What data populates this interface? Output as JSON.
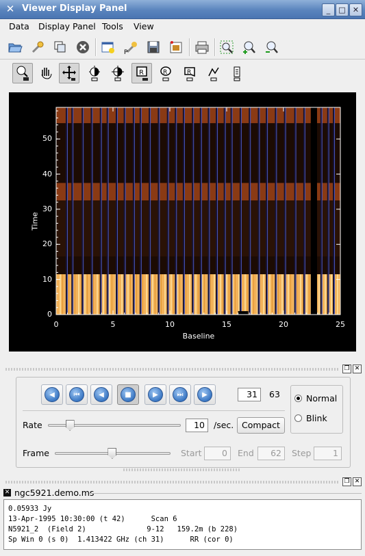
{
  "window": {
    "title": "Viewer Display Panel",
    "min_label": "_",
    "max_label": "□",
    "close_label": "✕"
  },
  "menu": [
    "Data",
    "Display Panel",
    "Tools",
    "View"
  ],
  "toolbar1": [
    "open-icon",
    "wrench-icon",
    "copy-icon",
    "close-circle-icon",
    "new-panel-icon",
    "print-setup-icon",
    "save-icon",
    "save-image-icon",
    "printer-icon",
    "zoom-fit-icon",
    "zoom-in-icon",
    "zoom-out-icon"
  ],
  "toolbar2": [
    "zoom-tool-icon",
    "pan-tool-icon",
    "crosshair-tool-icon",
    "contrast-tool-icon",
    "colormap-tool-icon",
    "rect-region-icon",
    "ellipse-region-icon",
    "poly-region-icon",
    "polyline-icon",
    "position-icon"
  ],
  "plot": {
    "ylabel": "Time",
    "xlabel": "Baseline",
    "xticks": [
      "0",
      "5",
      "10",
      "15",
      "20",
      "25"
    ],
    "yticks": [
      "0",
      "10",
      "20",
      "30",
      "40",
      "50"
    ]
  },
  "chart_data": {
    "type": "heatmap",
    "xlabel": "Baseline",
    "ylabel": "Time",
    "xlim": [
      0,
      25
    ],
    "ylim": [
      0,
      59
    ],
    "xticks": [
      0,
      5,
      10,
      15,
      20,
      25
    ],
    "yticks": [
      0,
      10,
      20,
      30,
      40,
      50
    ],
    "colormap": [
      "#000000",
      "#5a1e05",
      "#a0461a",
      "#f0a040",
      "#fff0c0"
    ],
    "bands": [
      {
        "from": 0,
        "to": 11.5,
        "level": "bright"
      },
      {
        "from": 11.5,
        "to": 16.5,
        "level": "dark"
      },
      {
        "from": 16.5,
        "to": 32.5,
        "level": "medium"
      },
      {
        "from": 32.5,
        "to": 37.5,
        "level": "bright-mid"
      },
      {
        "from": 37.5,
        "to": 54.5,
        "level": "dark"
      },
      {
        "from": 54.5,
        "to": 59,
        "level": "bright-mid"
      }
    ]
  },
  "animator": {
    "frame_value": "31",
    "frame_total": "63",
    "mode_normal": "Normal",
    "mode_blink": "Blink",
    "mode_selected": "Normal",
    "rate_label": "Rate",
    "rate_value": "10",
    "rate_unit": "/sec.",
    "rate_fraction": 0.14,
    "compact_label": "Compact",
    "frame_label": "Frame",
    "frame_fraction": 0.49,
    "start_label": "Start",
    "start_value": "0",
    "end_label": "End",
    "end_value": "62",
    "step_label": "Step",
    "step_value": "1"
  },
  "tracking": {
    "file": "ngc5921.demo.ms",
    "lines": [
      "0.05933 Jy",
      "13-Apr-1995 10:30:00 (t 42)      Scan 6",
      "N5921_2  (Field 2)              9-12   159.2m (b 228)",
      "Sp Win 0 (s 0)  1.413422 GHz (ch 31)      RR (cor 0)"
    ]
  }
}
